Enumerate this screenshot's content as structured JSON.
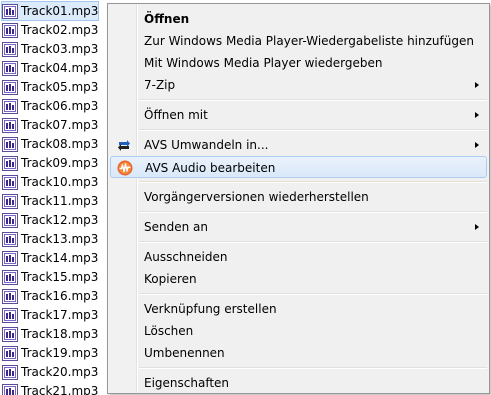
{
  "files": [
    {
      "name": "Track01.mp3",
      "selected": true
    },
    {
      "name": "Track02.mp3"
    },
    {
      "name": "Track03.mp3"
    },
    {
      "name": "Track04.mp3"
    },
    {
      "name": "Track05.mp3"
    },
    {
      "name": "Track06.mp3"
    },
    {
      "name": "Track07.mp3"
    },
    {
      "name": "Track08.mp3"
    },
    {
      "name": "Track09.mp3"
    },
    {
      "name": "Track10.mp3"
    },
    {
      "name": "Track11.mp3"
    },
    {
      "name": "Track12.mp3"
    },
    {
      "name": "Track13.mp3"
    },
    {
      "name": "Track14.mp3"
    },
    {
      "name": "Track15.mp3"
    },
    {
      "name": "Track16.mp3"
    },
    {
      "name": "Track17.mp3"
    },
    {
      "name": "Track18.mp3"
    },
    {
      "name": "Track19.mp3"
    },
    {
      "name": "Track20.mp3"
    },
    {
      "name": "Track21.mp3"
    }
  ],
  "file_icon": "audio-file-icon",
  "context_menu": {
    "items": [
      {
        "label": "Öffnen",
        "bold": true,
        "name": "menu-item-oeffnen"
      },
      {
        "label": "Zur Windows Media Player-Wiedergabeliste hinzufügen",
        "name": "menu-item-add-to-playlist"
      },
      {
        "label": "Mit Windows Media Player wiedergeben",
        "name": "menu-item-play-with-wmp"
      },
      {
        "label": "7-Zip",
        "submenu": true,
        "name": "menu-item-7zip"
      },
      {
        "separator": true
      },
      {
        "label": "Öffnen mit",
        "submenu": true,
        "name": "menu-item-open-with"
      },
      {
        "separator": true
      },
      {
        "label": "AVS Umwandeln in...",
        "submenu": true,
        "icon": "avs-convert-icon",
        "name": "menu-item-avs-convert"
      },
      {
        "label": "AVS Audio bearbeiten",
        "icon": "avs-audio-editor-icon",
        "highlighted": true,
        "name": "menu-item-avs-audio-edit"
      },
      {
        "separator": true
      },
      {
        "label": "Vorgängerversionen wiederherstellen",
        "name": "menu-item-restore-previous-versions"
      },
      {
        "separator": true
      },
      {
        "label": "Senden an",
        "submenu": true,
        "name": "menu-item-send-to"
      },
      {
        "separator": true
      },
      {
        "label": "Ausschneiden",
        "name": "menu-item-cut"
      },
      {
        "label": "Kopieren",
        "name": "menu-item-copy"
      },
      {
        "separator": true
      },
      {
        "label": "Verknüpfung erstellen",
        "name": "menu-item-create-shortcut"
      },
      {
        "label": "Löschen",
        "name": "menu-item-delete"
      },
      {
        "label": "Umbenennen",
        "name": "menu-item-rename"
      },
      {
        "separator": true
      },
      {
        "label": "Eigenschaften",
        "name": "menu-item-properties"
      }
    ]
  },
  "colors": {
    "menu_background": "#f0f0f0",
    "highlight": "#d9e8fa",
    "highlight_border": "#aeccf0",
    "file_selection": "#dcebfc"
  }
}
